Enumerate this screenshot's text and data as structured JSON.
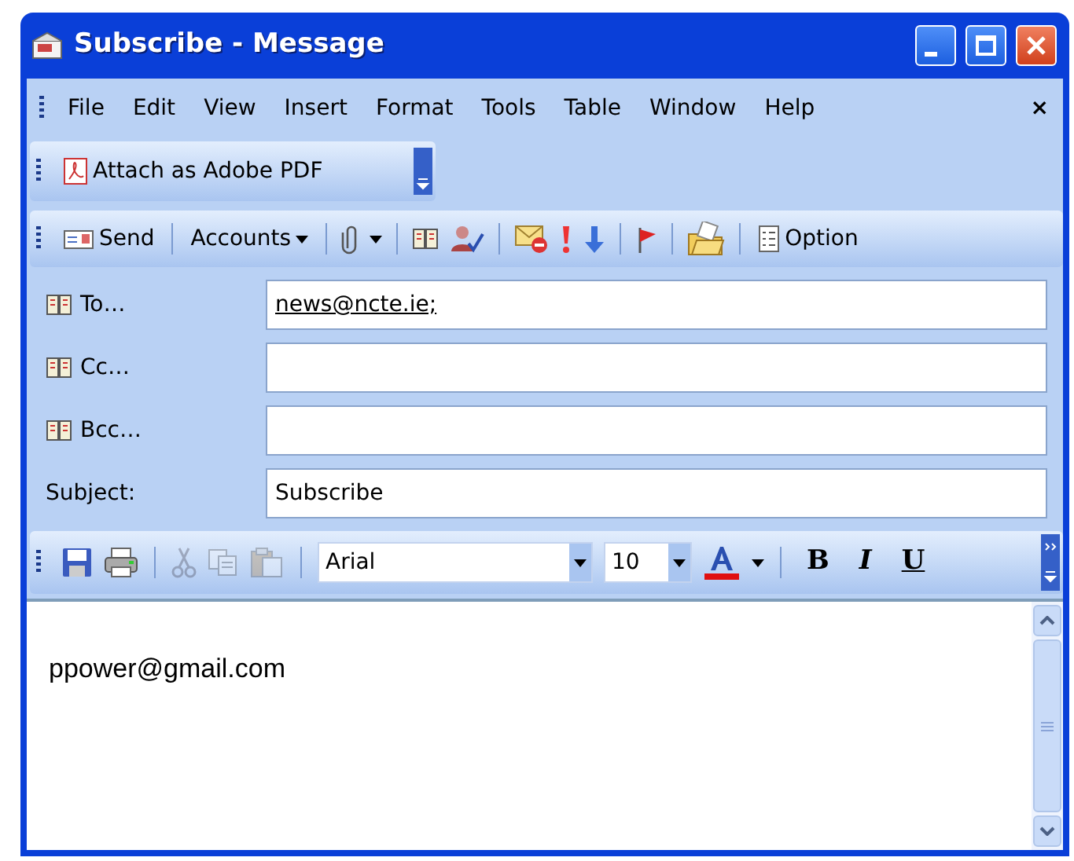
{
  "window": {
    "title": "Subscribe - Message"
  },
  "menu": [
    {
      "label": "File"
    },
    {
      "label": "Edit"
    },
    {
      "label": "View"
    },
    {
      "label": "Insert"
    },
    {
      "label": "Format"
    },
    {
      "label": "Tools"
    },
    {
      "label": "Table"
    },
    {
      "label": "Window"
    },
    {
      "label": "Help"
    }
  ],
  "menu_close": "×",
  "pdf_toolbar": {
    "label": "Attach as Adobe PDF"
  },
  "standard_toolbar": {
    "send": {
      "label": "Send"
    },
    "accounts": {
      "label": "Accounts"
    },
    "options": {
      "label": "Option"
    }
  },
  "fields": [
    {
      "kind": "address",
      "label": "To…",
      "value": "news@ncte.ie;"
    },
    {
      "kind": "address",
      "label": "Cc…"
    },
    {
      "kind": "address",
      "label": "Bcc…"
    },
    {
      "kind": "plain",
      "label": "Subject:",
      "value": "Subscribe"
    }
  ],
  "format_toolbar": {
    "font": "Arial",
    "size": "10",
    "clipboard_disabled": true,
    "bold": "B",
    "italic": "I",
    "underline": "U"
  },
  "body": "ppower@gmail.com"
}
